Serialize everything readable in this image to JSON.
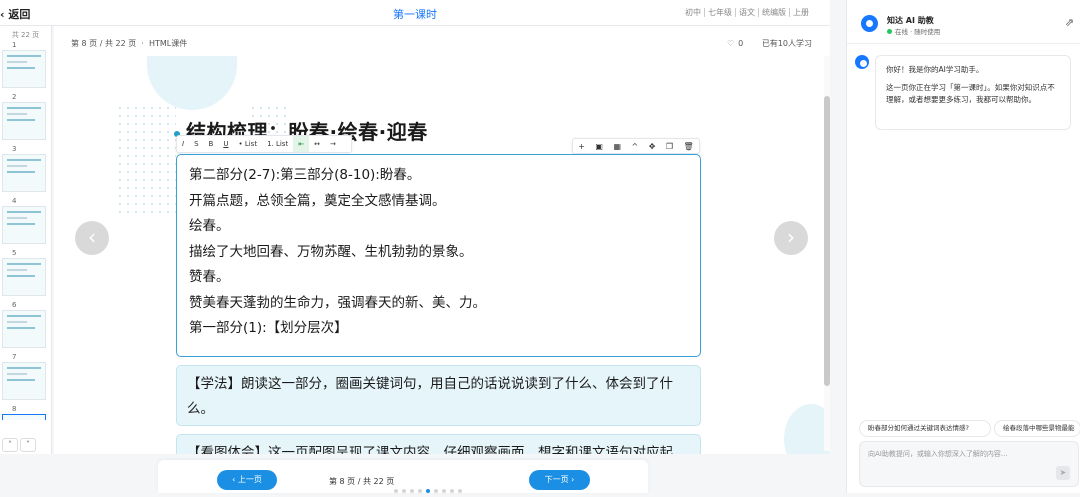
{
  "topbar": {
    "back_label": "返回",
    "title": "第一课时",
    "meta": [
      "初中",
      "七年级",
      "语文",
      "统编版",
      "上册"
    ]
  },
  "thumbs": {
    "count_label": "共 22 页",
    "pages": [
      "1",
      "2",
      "3",
      "4",
      "5",
      "6",
      "7",
      "8"
    ]
  },
  "stage": {
    "page_info": "第 8 页 / 共 22 页",
    "type_label": "HTML课件",
    "likes": "0",
    "learners": "已有10人学习",
    "heading": "结构梳理：盼春·绘春·迎春",
    "format_toolbar": [
      "I",
      "S",
      "B",
      "U",
      "• List",
      "1. List",
      "⇤",
      "↔",
      "→"
    ],
    "block_toolbar": [
      "+",
      "▣",
      "▦",
      "^",
      "✥",
      "❐",
      "🗑"
    ],
    "card_lines": [
      "第二部分(2-7):第三部分(8-10):盼春。",
      "开篇点题，总领全篇，奠定全文感情基调。",
      "绘春。",
      "描绘了大地回春、万物苏醒、生机勃勃的景象。",
      "赞春。",
      "赞美春天蓬勃的生命力，强调春天的新、美、力。",
      "第一部分(1):【划分层次】"
    ],
    "tip_text": "【学法】朗读这一部分，圈画关键词句，用自己的话说说读到了什么、体会到了什么。",
    "tip2_text": "【看图体会】这一页配图呈现了课文内容，仔细观察画面，想字和课文语句对应起"
  },
  "bottombar": {
    "prev_label": "‹  上一页",
    "page_info": "第 8 页 / 共 22 页",
    "next_label": "下一页  ›",
    "dots_total": 9,
    "dots_current": 5
  },
  "assistant": {
    "name": "知达 AI 助教",
    "status": "在线 · 随时使用",
    "greeting": "你好！我是你的AI学习助手。",
    "message": "这一页你正在学习「第一课时」。如果你对知识点不理解，或者想要更多练习，我都可以帮助你。",
    "suggestions": [
      "盼春部分如何通过关键词表达情感?",
      "绘春段落中哪些景物最能"
    ],
    "input_placeholder": "向AI助教提问，或输入你想深入了解的内容..."
  },
  "colors": {
    "accent": "#1677ff",
    "nav_button": "#1a8fe3",
    "card_border": "#3aa0d8",
    "tip_bg": "#e6f5fa"
  }
}
